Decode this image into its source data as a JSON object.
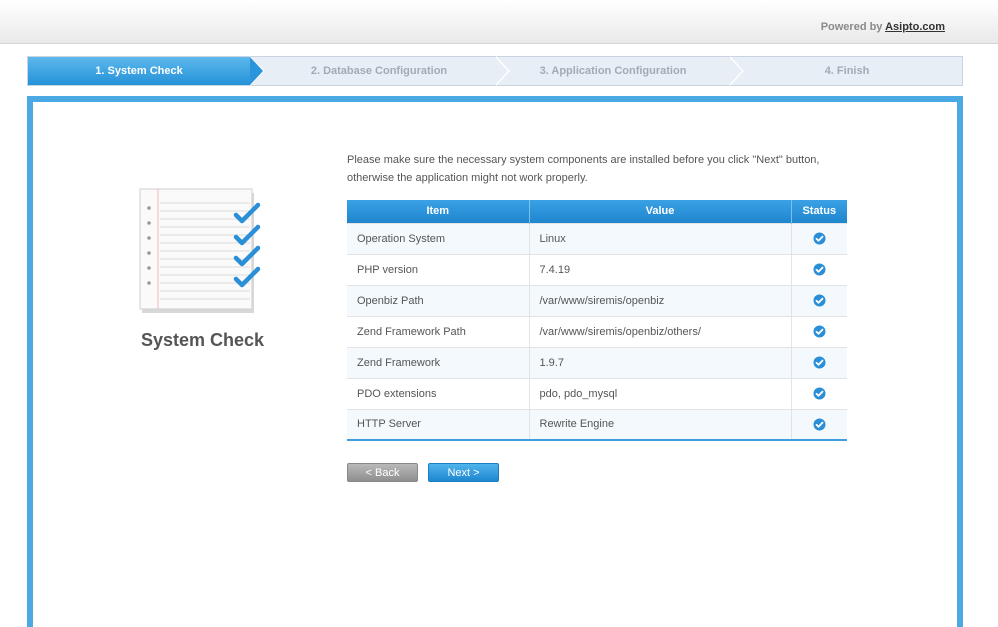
{
  "header": {
    "powered_prefix": "Powered by",
    "powered_link": "Asipto.com"
  },
  "steps": [
    {
      "label": "1. System Check",
      "active": true
    },
    {
      "label": "2. Database Configuration",
      "active": false
    },
    {
      "label": "3. Application Configuration",
      "active": false
    },
    {
      "label": "4. Finish",
      "active": false
    }
  ],
  "sidebar": {
    "title": "System Check",
    "icon": "checklist-icon"
  },
  "main": {
    "intro": "Please make sure the necessary system components are installed before you click \"Next\" button, otherwise the application might not work properly.",
    "table": {
      "headers": [
        "Item",
        "Value",
        "Status"
      ],
      "rows": [
        {
          "item": "Operation System",
          "value": "Linux",
          "status": "ok"
        },
        {
          "item": "PHP version",
          "value": "7.4.19",
          "status": "ok"
        },
        {
          "item": "Openbiz Path",
          "value": "/var/www/siremis/openbiz",
          "status": "ok"
        },
        {
          "item": "Zend Framework Path",
          "value": "/var/www/siremis/openbiz/others/",
          "status": "ok"
        },
        {
          "item": "Zend Framework",
          "value": "1.9.7",
          "status": "ok"
        },
        {
          "item": "PDO extensions",
          "value": "pdo, pdo_mysql",
          "status": "ok"
        },
        {
          "item": "HTTP Server",
          "value": "Rewrite Engine",
          "status": "ok"
        }
      ]
    },
    "buttons": {
      "back": "< Back",
      "next": "Next >"
    }
  },
  "colors": {
    "accent": "#4aa8e2",
    "active_step": "#2592d8",
    "check": "#2a8fd6"
  }
}
